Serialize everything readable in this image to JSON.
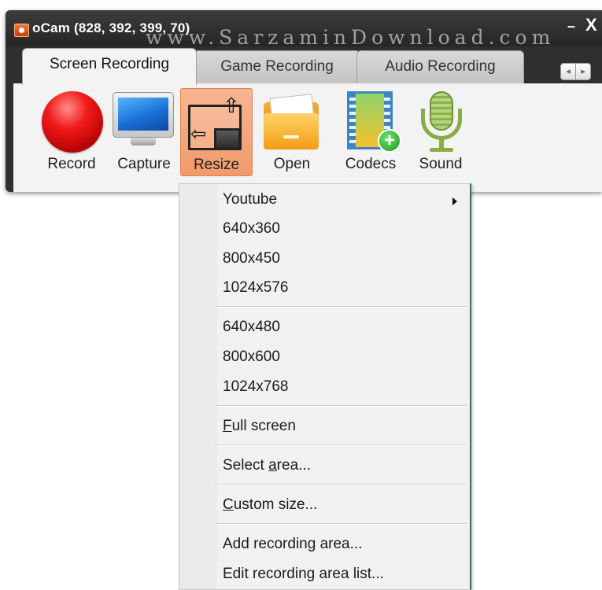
{
  "window": {
    "title": "oCam (828, 392, 399, 70)",
    "watermark": "www.SarzaminDownload.com",
    "minimize": "–",
    "close": "X"
  },
  "tabs": [
    {
      "label": "Screen Recording",
      "active": true
    },
    {
      "label": "Game Recording",
      "active": false
    },
    {
      "label": "Audio Recording",
      "active": false
    }
  ],
  "tab_scroll": {
    "left": "◂",
    "right": "▸"
  },
  "toolbar": {
    "record": {
      "label": "Record",
      "icon": "record-icon"
    },
    "capture": {
      "label": "Capture",
      "icon": "monitor-icon"
    },
    "resize": {
      "label": "Resize",
      "icon": "resize-icon",
      "selected": true
    },
    "open": {
      "label": "Open",
      "icon": "folder-icon"
    },
    "codecs": {
      "label": "Codecs",
      "icon": "film-plus-icon"
    },
    "sound": {
      "label": "Sound",
      "icon": "microphone-icon"
    }
  },
  "menu": {
    "youtube": "Youtube",
    "r640x360": "640x360",
    "r800x450": "800x450",
    "r1024x576": "1024x576",
    "r640x480": "640x480",
    "r800x600": "800x600",
    "r1024x768": "1024x768",
    "full_screen": {
      "mnemonic": "F",
      "rest": "ull screen"
    },
    "select_area": {
      "pre": "Select ",
      "mnemonic": "a",
      "rest": "rea..."
    },
    "custom_size": {
      "mnemonic": "C",
      "rest": "ustom size..."
    },
    "add_area": "Add recording area...",
    "edit_area": "Edit recording area list..."
  },
  "colors": {
    "titlebar": "#2f2f2f",
    "toolbar_bg": "#f3f3f3",
    "resize_highlight": "#f19a6d",
    "menu_bg": "#f1f1f1"
  }
}
